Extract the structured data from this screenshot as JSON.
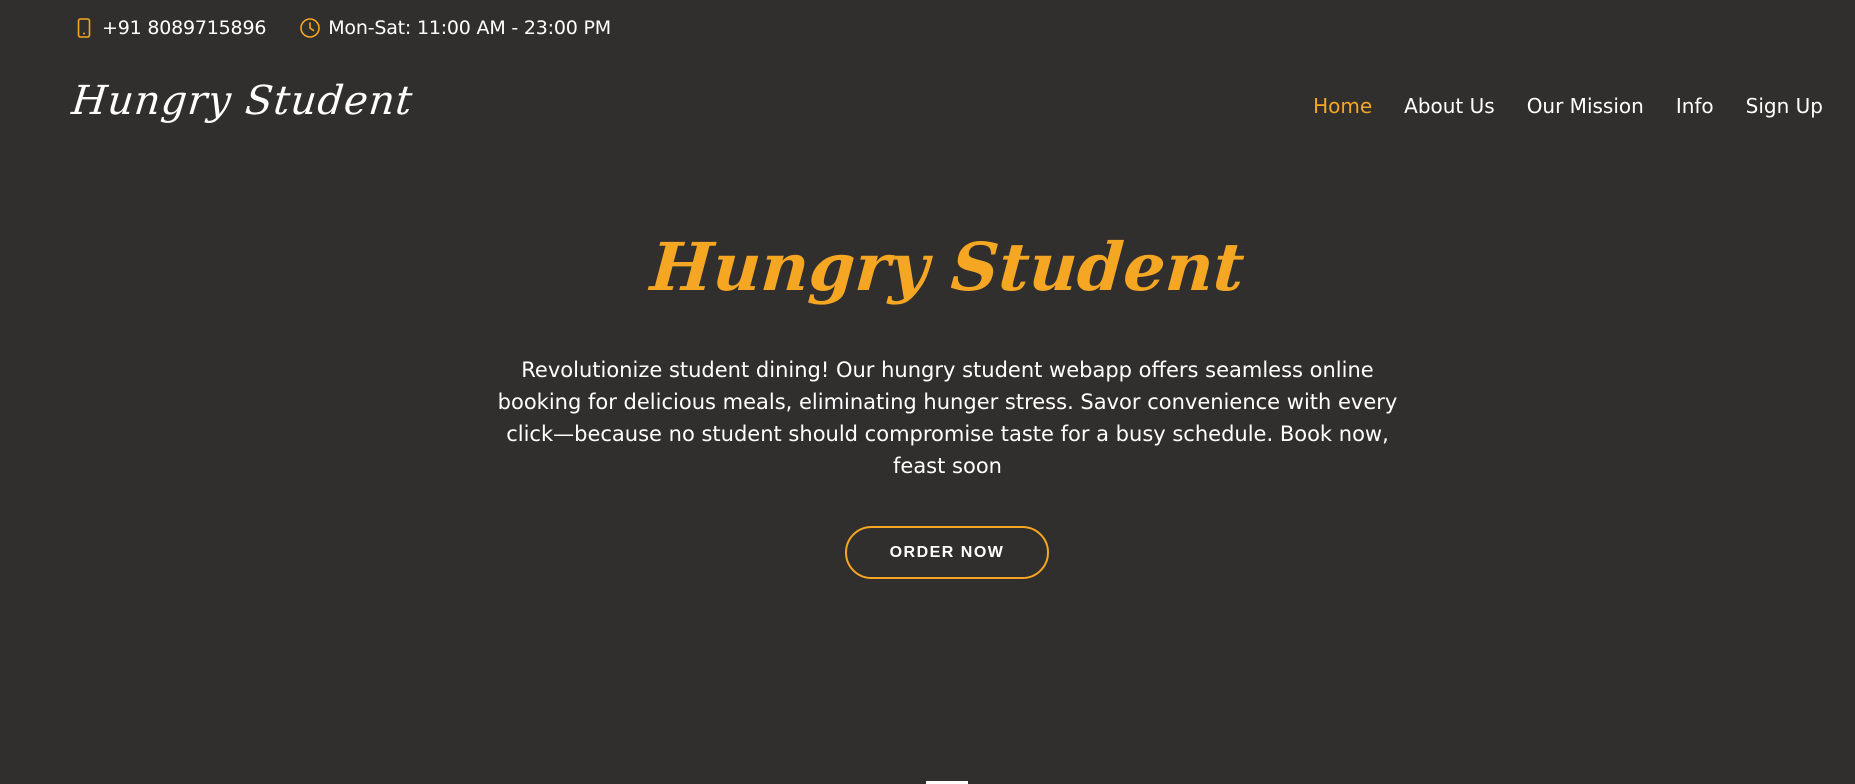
{
  "topbar": {
    "phone": "+91 8089715896",
    "hours": "Mon-Sat: 11:00 AM - 23:00 PM",
    "phone_icon": "mobile-phone-icon",
    "hours_icon": "clock-icon"
  },
  "brand": {
    "logo_text": "Hungry Student"
  },
  "nav": {
    "items": [
      {
        "label": "Home",
        "active": true
      },
      {
        "label": "About Us",
        "active": false
      },
      {
        "label": "Our Mission",
        "active": false
      },
      {
        "label": "Info",
        "active": false
      },
      {
        "label": "Sign Up",
        "active": false
      }
    ]
  },
  "hero": {
    "title": "Hungry Student",
    "description": "Revolutionize student dining! Our hungry student webapp offers seamless online booking for delicious meals, eliminating hunger stress. Savor convenience with every click—because no student should compromise taste for a busy schedule. Book now, feast soon",
    "cta_label": "ORDER NOW"
  },
  "colors": {
    "background": "#302f2e",
    "accent": "#f5a623",
    "text": "#ffffff"
  }
}
